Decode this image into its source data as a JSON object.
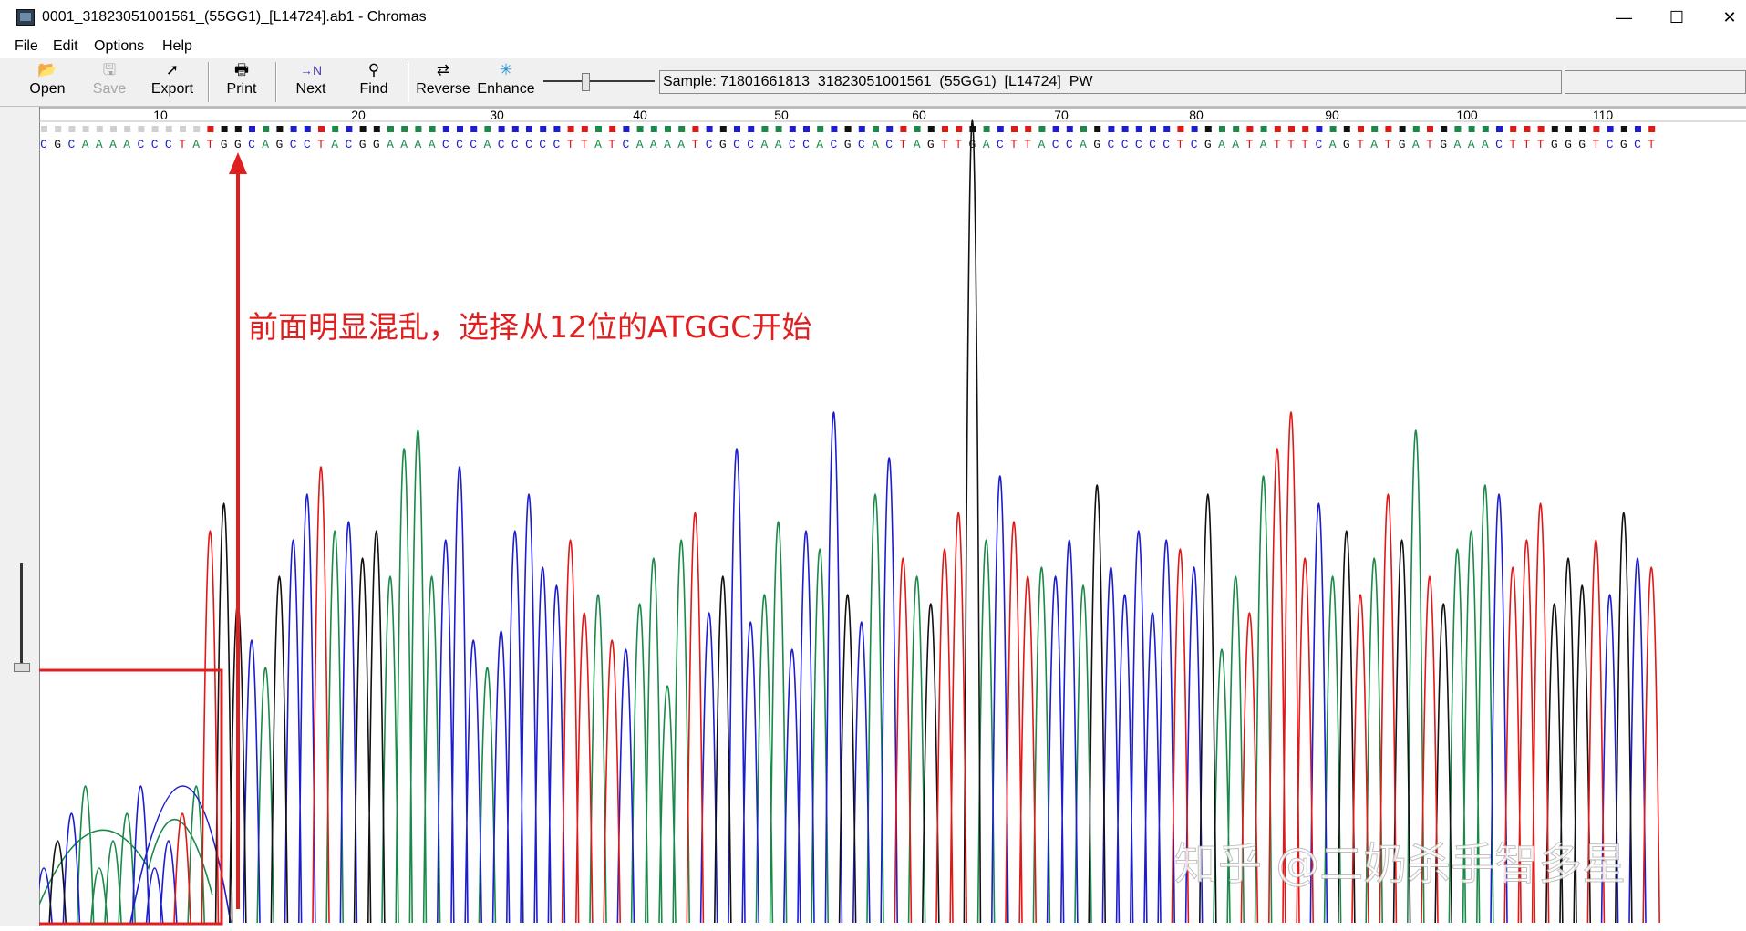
{
  "window": {
    "title": "0001_31823051001561_(55GG1)_[L14724].ab1 - Chromas",
    "minimize": "—",
    "maximize": "☐",
    "close": "✕"
  },
  "menu": [
    "File",
    "Edit",
    "Options",
    "Help"
  ],
  "toolbar": {
    "open": "Open",
    "save": "Save",
    "export": "Export",
    "print": "Print",
    "next": "Next",
    "find": "Find",
    "reverse": "Reverse",
    "enhance": "Enhance"
  },
  "sample_label": "Sample: 71801661813_31823051001561_(55GG1)_[L14724]_PW",
  "ruler": [
    "10",
    "20",
    "30",
    "40",
    "50",
    "60",
    "70",
    "80",
    "90",
    "100",
    "110"
  ],
  "sequence": "CGCAAAACCCTATGGCAGCCTACGGAAAACCCACCCCCTTATCAAAATCGCCAACCACGCACTAGTTGACTTACCAGCCCCCTCGAATATTTCAGTATGATGAAACTTTGGGTCGCT",
  "base_colors": {
    "A": "#1a8a4a",
    "C": "#1d1dd0",
    "G": "#111111",
    "T": "#e01818"
  },
  "annotation": "前面明显混乱，选择从12位的ATGGC开始",
  "annotation_color": "#e02020",
  "watermark": "知乎 @二奶杀手智多星"
}
